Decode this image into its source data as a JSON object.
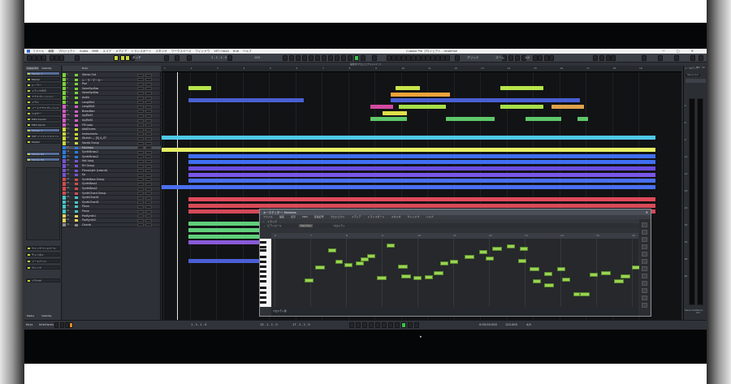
{
  "window": {
    "title": "Cubase Pro プロジェクト - dcadmse",
    "menu": [
      "ファイル",
      "編集",
      "プロジェクト",
      "Audio",
      "MIDI",
      "スコア",
      "メディア",
      "トランスポート",
      "スタジオ",
      "ワークスペース",
      "ウィンドウ",
      "VST Cloud",
      "Hub",
      "ヘルプ"
    ],
    "subtitle": "編集中プロジェクト(メイン)"
  },
  "toolbar": {
    "mode_label": "タッチ",
    "position": "1 . 1 . 1 . 0",
    "tempo": "120",
    "grid_label": "グリッド",
    "quantize": "1/4",
    "zoom_label": "ズーム"
  },
  "inspector": {
    "tabs": [
      "Inspector",
      "Visibility"
    ],
    "items": [
      {
        "label": "Marker 1",
        "state": "hl"
      },
      {
        "label": "Marker",
        "state": ""
      },
      {
        "label": "ルーラー",
        "state": ""
      },
      {
        "label": "トラック表示",
        "state": ""
      },
      {
        "label": "エクスプレッション",
        "state": ""
      },
      {
        "label": "ドラム",
        "state": ""
      },
      {
        "label": "ノートエクスプレッション",
        "state": ""
      },
      {
        "label": "ミキサー",
        "state": ""
      },
      {
        "label": "MIDI Inserts",
        "state": ""
      },
      {
        "label": "MIDI Sends",
        "state": ""
      },
      {
        "label": "Marker 1",
        "state": "hl"
      },
      {
        "label": "VST インストゥルメント",
        "state": ""
      },
      {
        "label": "Master",
        "state": ""
      },
      {
        "label": "Marker B1",
        "state": "hl"
      },
      {
        "label": "Marker B2",
        "state": "hl"
      },
      {
        "label": "クイックコントロール",
        "state": ""
      },
      {
        "label": "チャンネル",
        "state": ""
      },
      {
        "label": "ノートパッド",
        "state": ""
      },
      {
        "label": "クイック",
        "state": ""
      },
      {
        "label": "ブラウザ",
        "state": ""
      }
    ],
    "bottom_tabs": [
      "Media",
      "Visibility"
    ]
  },
  "tracklist": {
    "header": "Note",
    "rows": [
      {
        "name": "Stereo Out",
        "color": "#7ad13a"
      },
      {
        "name": "ルーラーマーカー",
        "color": "#7ad13a"
      },
      {
        "name": "Pad",
        "color": "#7ad13a"
      },
      {
        "name": "VoiceSynBas",
        "color": "#7ad13a"
      },
      {
        "name": "VoiceSynBas",
        "color": "#7ad13a"
      },
      {
        "name": "Audio",
        "color": "#7ad13a"
      },
      {
        "name": "LongOtb1",
        "color": "#7ad13a"
      },
      {
        "name": "LongOtb2",
        "color": "#d35bc4"
      },
      {
        "name": "BrassMan",
        "color": "#d35bc4"
      },
      {
        "name": "Up/Bell1",
        "color": "#d35bc4"
      },
      {
        "name": "Up/Bell2",
        "color": "#d35bc4"
      },
      {
        "name": "FM Loop",
        "color": "#d35bc4"
      },
      {
        "name": "AddDrums",
        "color": "#c8d63a"
      },
      {
        "name": "Instruments",
        "color": "#c8d63a"
      },
      {
        "name": "Stretch — [S] A_ST",
        "color": "#c8d63a"
      },
      {
        "name": "Vocals Group",
        "color": "#c8d63a"
      },
      {
        "name": "Marimba",
        "color": "#2a7be3"
      },
      {
        "name": "SynthBrass1",
        "color": "#2a7be3"
      },
      {
        "name": "SynthBrass2",
        "color": "#2a7be3"
      },
      {
        "name": "Hot Long",
        "color": "#7a52d4"
      },
      {
        "name": "RH Group",
        "color": "#7a52d4"
      },
      {
        "name": "PianoLight (Lowcut)",
        "color": "#7a52d4"
      },
      {
        "name": "Ka",
        "color": "#7a52d4"
      },
      {
        "name": "SynthBass Group",
        "color": "#d34b4b"
      },
      {
        "name": "SynthBass1",
        "color": "#d34b4b"
      },
      {
        "name": "SynthBass2",
        "color": "#d34b4b"
      },
      {
        "name": "SynthChord Group",
        "color": "#d34b4b"
      },
      {
        "name": "SynthChord1",
        "color": "#48c4c4"
      },
      {
        "name": "SynthChord2",
        "color": "#48c4c4"
      },
      {
        "name": "Piano",
        "color": "#48c4c4"
      },
      {
        "name": "Piano",
        "color": "#48c4c4"
      },
      {
        "name": "PadSynth1",
        "color": "#e8d35b"
      },
      {
        "name": "PadSynth2",
        "color": "#e8d35b"
      },
      {
        "name": "Chords",
        "color": "#8a8a8a"
      }
    ]
  },
  "ruler": {
    "bars": [
      "1",
      "2",
      "3",
      "4",
      "5",
      "6",
      "7",
      "8",
      "9",
      "10",
      "11",
      "12",
      "13",
      "14",
      "15",
      "16",
      "17",
      "18",
      "19"
    ]
  },
  "key_editor": {
    "title": "キーエディター: Marimba",
    "menu": [
      "ファイル",
      "編集",
      "表示",
      "MIDI",
      "音楽記号",
      "プロジェクト",
      "メディア",
      "トランスポート",
      "スタジオ",
      "ウィンドウ",
      "ヘルプ"
    ],
    "track_label": "トラック",
    "part_label": "ピアノロール",
    "part_name": "Marimba",
    "velocity_label": "ベロシティ",
    "bars": [
      "6",
      "7",
      "8",
      "9",
      "10",
      "11",
      "12",
      "13",
      "14",
      "15",
      "16"
    ],
    "footer": "ベロシティ値"
  },
  "mixer": {
    "tabs": [
      "ルーター",
      "メディア",
      "MIX",
      "CR"
    ],
    "channel": "Stereo Out",
    "labels": [
      "-3",
      "-6",
      "-9",
      "-12",
      "-15",
      "-18",
      "-24",
      "-30",
      "-36",
      "-48",
      "-60"
    ],
    "bottom": [
      "Stereo Out",
      "Stereo Out"
    ]
  },
  "transport": {
    "position": "1 . 1 . 1 . 0",
    "left_locator": "13 . 1 . 1 . 0",
    "right_locator": "17 . 1 . 1 . 0",
    "time": "0:00:00.000",
    "tempo": "120.000",
    "signature": "4/4",
    "bottom_tabs": [
      "Keys",
      "Interfaces"
    ]
  }
}
